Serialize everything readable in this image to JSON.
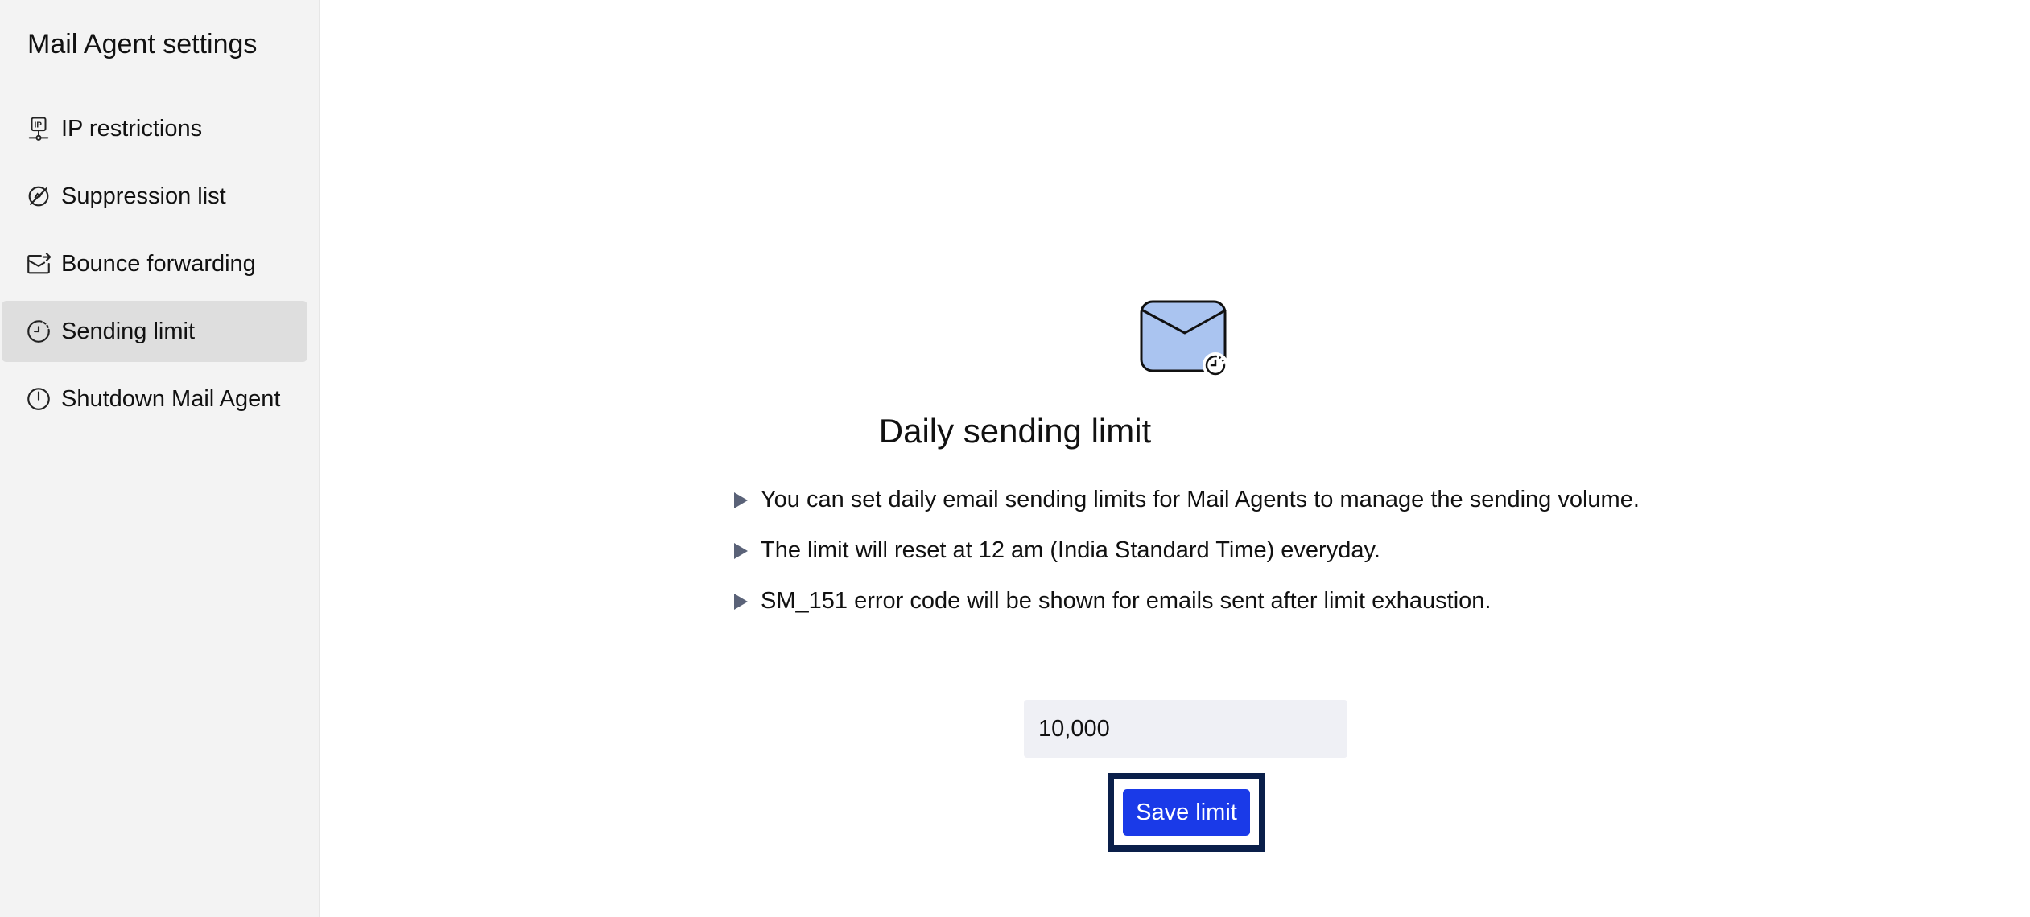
{
  "sidebar": {
    "title": "Mail Agent settings",
    "items": [
      {
        "label": "IP restrictions",
        "icon": "ip-restriction-icon"
      },
      {
        "label": "Suppression list",
        "icon": "suppression-icon"
      },
      {
        "label": "Bounce forwarding",
        "icon": "bounce-forwarding-icon"
      },
      {
        "label": "Sending limit",
        "icon": "sending-limit-icon",
        "active": true
      },
      {
        "label": "Shutdown Mail Agent",
        "icon": "power-icon"
      }
    ]
  },
  "main": {
    "hero_icon": "mail-clock-icon",
    "title": "Daily sending limit",
    "bullets": [
      "You can set daily email sending limits for Mail Agents to manage the sending volume.",
      "The limit will reset at 12 am (India Standard Time) everyday.",
      "SM_151 error code will be shown for emails sent after limit exhaustion."
    ],
    "limit_value": "10,000",
    "save_label": "Save limit"
  },
  "colors": {
    "accent": "#1a3ae8",
    "focus_ring": "#0a1f4a",
    "sidebar_bg": "#f3f3f3",
    "active_item_bg": "#dedede",
    "envelope_fill": "#aac4f0",
    "bullet_arrow": "#5a6278",
    "input_bg": "#eff0f5"
  }
}
